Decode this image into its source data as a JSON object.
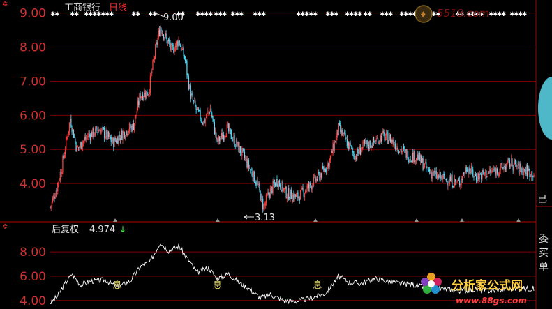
{
  "header": {
    "stock_name": "工商银行",
    "period": "日线"
  },
  "sub_header": {
    "indicator": "后复权",
    "value": "4.974",
    "arrow": "↓"
  },
  "right_panel": {
    "label1": "已",
    "label2": "委",
    "label3": "买",
    "label4": "单"
  },
  "watermarks": {
    "top_site": "5518.com",
    "bottom_brand": "分析家公式网",
    "bottom_url": "www.88gs.com"
  },
  "colors": {
    "up": "#ff4444",
    "down": "#55e0ff",
    "axis_text": "#d03030",
    "grid": "#7a0000",
    "sub_line": "#ffffff",
    "marker": "#e0d060"
  },
  "chart_data": [
    {
      "type": "candlestick",
      "title": "工商银行 日线",
      "ylim": [
        3.0,
        9.3
      ],
      "y_ticks": [
        "9.00",
        "8.00",
        "7.00",
        "6.00",
        "5.00",
        "4.00"
      ],
      "annotations": [
        {
          "text": "9.00",
          "value": 9.0
        },
        {
          "text": "3.13",
          "value": 3.13
        }
      ],
      "close_trend": [
        {
          "i": 0,
          "v": 3.3
        },
        {
          "i": 8,
          "v": 3.9
        },
        {
          "i": 14,
          "v": 4.5
        },
        {
          "i": 24,
          "v": 5.9
        },
        {
          "i": 32,
          "v": 5.0
        },
        {
          "i": 45,
          "v": 5.4
        },
        {
          "i": 60,
          "v": 5.6
        },
        {
          "i": 75,
          "v": 5.2
        },
        {
          "i": 88,
          "v": 5.5
        },
        {
          "i": 100,
          "v": 5.7
        },
        {
          "i": 108,
          "v": 6.6
        },
        {
          "i": 118,
          "v": 6.7
        },
        {
          "i": 126,
          "v": 7.9
        },
        {
          "i": 132,
          "v": 8.6
        },
        {
          "i": 138,
          "v": 8.3
        },
        {
          "i": 146,
          "v": 7.9
        },
        {
          "i": 154,
          "v": 8.2
        },
        {
          "i": 162,
          "v": 7.6
        },
        {
          "i": 168,
          "v": 6.6
        },
        {
          "i": 176,
          "v": 6.1
        },
        {
          "i": 184,
          "v": 5.8
        },
        {
          "i": 192,
          "v": 6.2
        },
        {
          "i": 200,
          "v": 5.2
        },
        {
          "i": 212,
          "v": 5.6
        },
        {
          "i": 222,
          "v": 5.2
        },
        {
          "i": 232,
          "v": 4.8
        },
        {
          "i": 240,
          "v": 4.4
        },
        {
          "i": 248,
          "v": 4.0
        },
        {
          "i": 256,
          "v": 3.3
        },
        {
          "i": 262,
          "v": 3.7
        },
        {
          "i": 272,
          "v": 4.1
        },
        {
          "i": 284,
          "v": 3.7
        },
        {
          "i": 296,
          "v": 3.6
        },
        {
          "i": 310,
          "v": 3.9
        },
        {
          "i": 322,
          "v": 4.2
        },
        {
          "i": 334,
          "v": 4.6
        },
        {
          "i": 346,
          "v": 5.6
        },
        {
          "i": 356,
          "v": 5.2
        },
        {
          "i": 366,
          "v": 4.8
        },
        {
          "i": 376,
          "v": 5.1
        },
        {
          "i": 388,
          "v": 5.2
        },
        {
          "i": 398,
          "v": 5.4
        },
        {
          "i": 408,
          "v": 5.3
        },
        {
          "i": 420,
          "v": 5.0
        },
        {
          "i": 430,
          "v": 4.8
        },
        {
          "i": 440,
          "v": 4.8
        },
        {
          "i": 452,
          "v": 4.4
        },
        {
          "i": 464,
          "v": 4.2
        },
        {
          "i": 478,
          "v": 4.1
        },
        {
          "i": 490,
          "v": 4.0
        },
        {
          "i": 500,
          "v": 4.5
        },
        {
          "i": 510,
          "v": 4.2
        },
        {
          "i": 524,
          "v": 4.3
        },
        {
          "i": 538,
          "v": 4.4
        },
        {
          "i": 552,
          "v": 4.6
        },
        {
          "i": 566,
          "v": 4.4
        },
        {
          "i": 580,
          "v": 4.3
        }
      ]
    },
    {
      "type": "line",
      "title": "后复权 4.974",
      "ylim": [
        3.7,
        9.5
      ],
      "y_ticks": [
        "8.00",
        "6.00",
        "4.00"
      ],
      "markers": [
        "息",
        "息",
        "息"
      ],
      "close_trend": [
        {
          "i": 0,
          "v": 3.8
        },
        {
          "i": 8,
          "v": 4.3
        },
        {
          "i": 18,
          "v": 5.4
        },
        {
          "i": 26,
          "v": 6.2
        },
        {
          "i": 36,
          "v": 5.3
        },
        {
          "i": 50,
          "v": 5.6
        },
        {
          "i": 66,
          "v": 5.7
        },
        {
          "i": 80,
          "v": 5.1
        },
        {
          "i": 96,
          "v": 5.6
        },
        {
          "i": 108,
          "v": 6.8
        },
        {
          "i": 120,
          "v": 7.2
        },
        {
          "i": 132,
          "v": 8.8
        },
        {
          "i": 142,
          "v": 8.1
        },
        {
          "i": 154,
          "v": 8.5
        },
        {
          "i": 164,
          "v": 7.5
        },
        {
          "i": 176,
          "v": 6.3
        },
        {
          "i": 190,
          "v": 6.7
        },
        {
          "i": 200,
          "v": 5.8
        },
        {
          "i": 214,
          "v": 6.2
        },
        {
          "i": 226,
          "v": 5.5
        },
        {
          "i": 238,
          "v": 5.0
        },
        {
          "i": 252,
          "v": 4.2
        },
        {
          "i": 264,
          "v": 4.5
        },
        {
          "i": 280,
          "v": 4.0
        },
        {
          "i": 296,
          "v": 3.95
        },
        {
          "i": 312,
          "v": 4.2
        },
        {
          "i": 330,
          "v": 4.6
        },
        {
          "i": 346,
          "v": 6.0
        },
        {
          "i": 358,
          "v": 5.5
        },
        {
          "i": 372,
          "v": 5.4
        },
        {
          "i": 390,
          "v": 5.8
        },
        {
          "i": 404,
          "v": 5.6
        },
        {
          "i": 420,
          "v": 5.4
        },
        {
          "i": 436,
          "v": 5.3
        },
        {
          "i": 452,
          "v": 5.0
        },
        {
          "i": 470,
          "v": 5.0
        },
        {
          "i": 490,
          "v": 4.8
        },
        {
          "i": 510,
          "v": 4.9
        },
        {
          "i": 530,
          "v": 4.8
        },
        {
          "i": 550,
          "v": 5.0
        },
        {
          "i": 580,
          "v": 4.97
        }
      ]
    }
  ]
}
